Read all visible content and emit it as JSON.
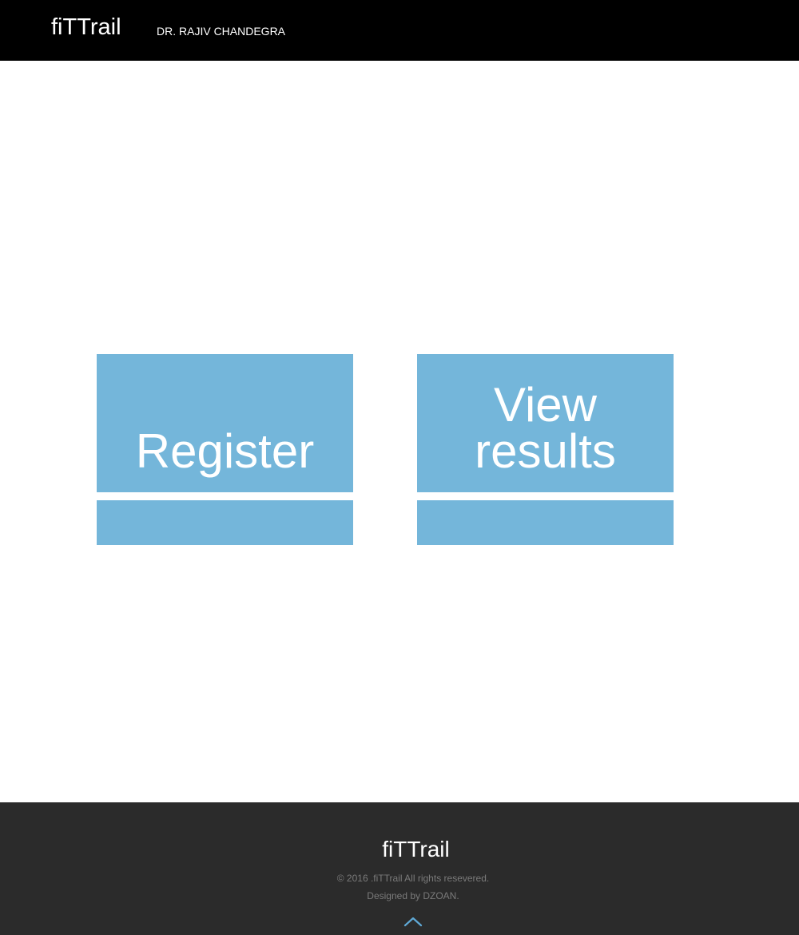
{
  "header": {
    "brand": "fiTTrail",
    "user_name": "DR. RAJIV CHANDEGRA"
  },
  "tiles": {
    "register_label": "Register",
    "view_results_label": "View\nresults"
  },
  "footer": {
    "brand": "fiTTrail",
    "copyright": "© 2016 .fiTTrail All rights resevered.",
    "credit": "Designed by DZOAN.",
    "scroll_top_icon": "chevron-up-icon"
  },
  "colors": {
    "header_bg": "#000000",
    "tile_bg": "#74b6da",
    "footer_bg": "#2b2b2b",
    "footer_text": "#7a7a7a",
    "accent_arrow": "#5fa9d6"
  }
}
